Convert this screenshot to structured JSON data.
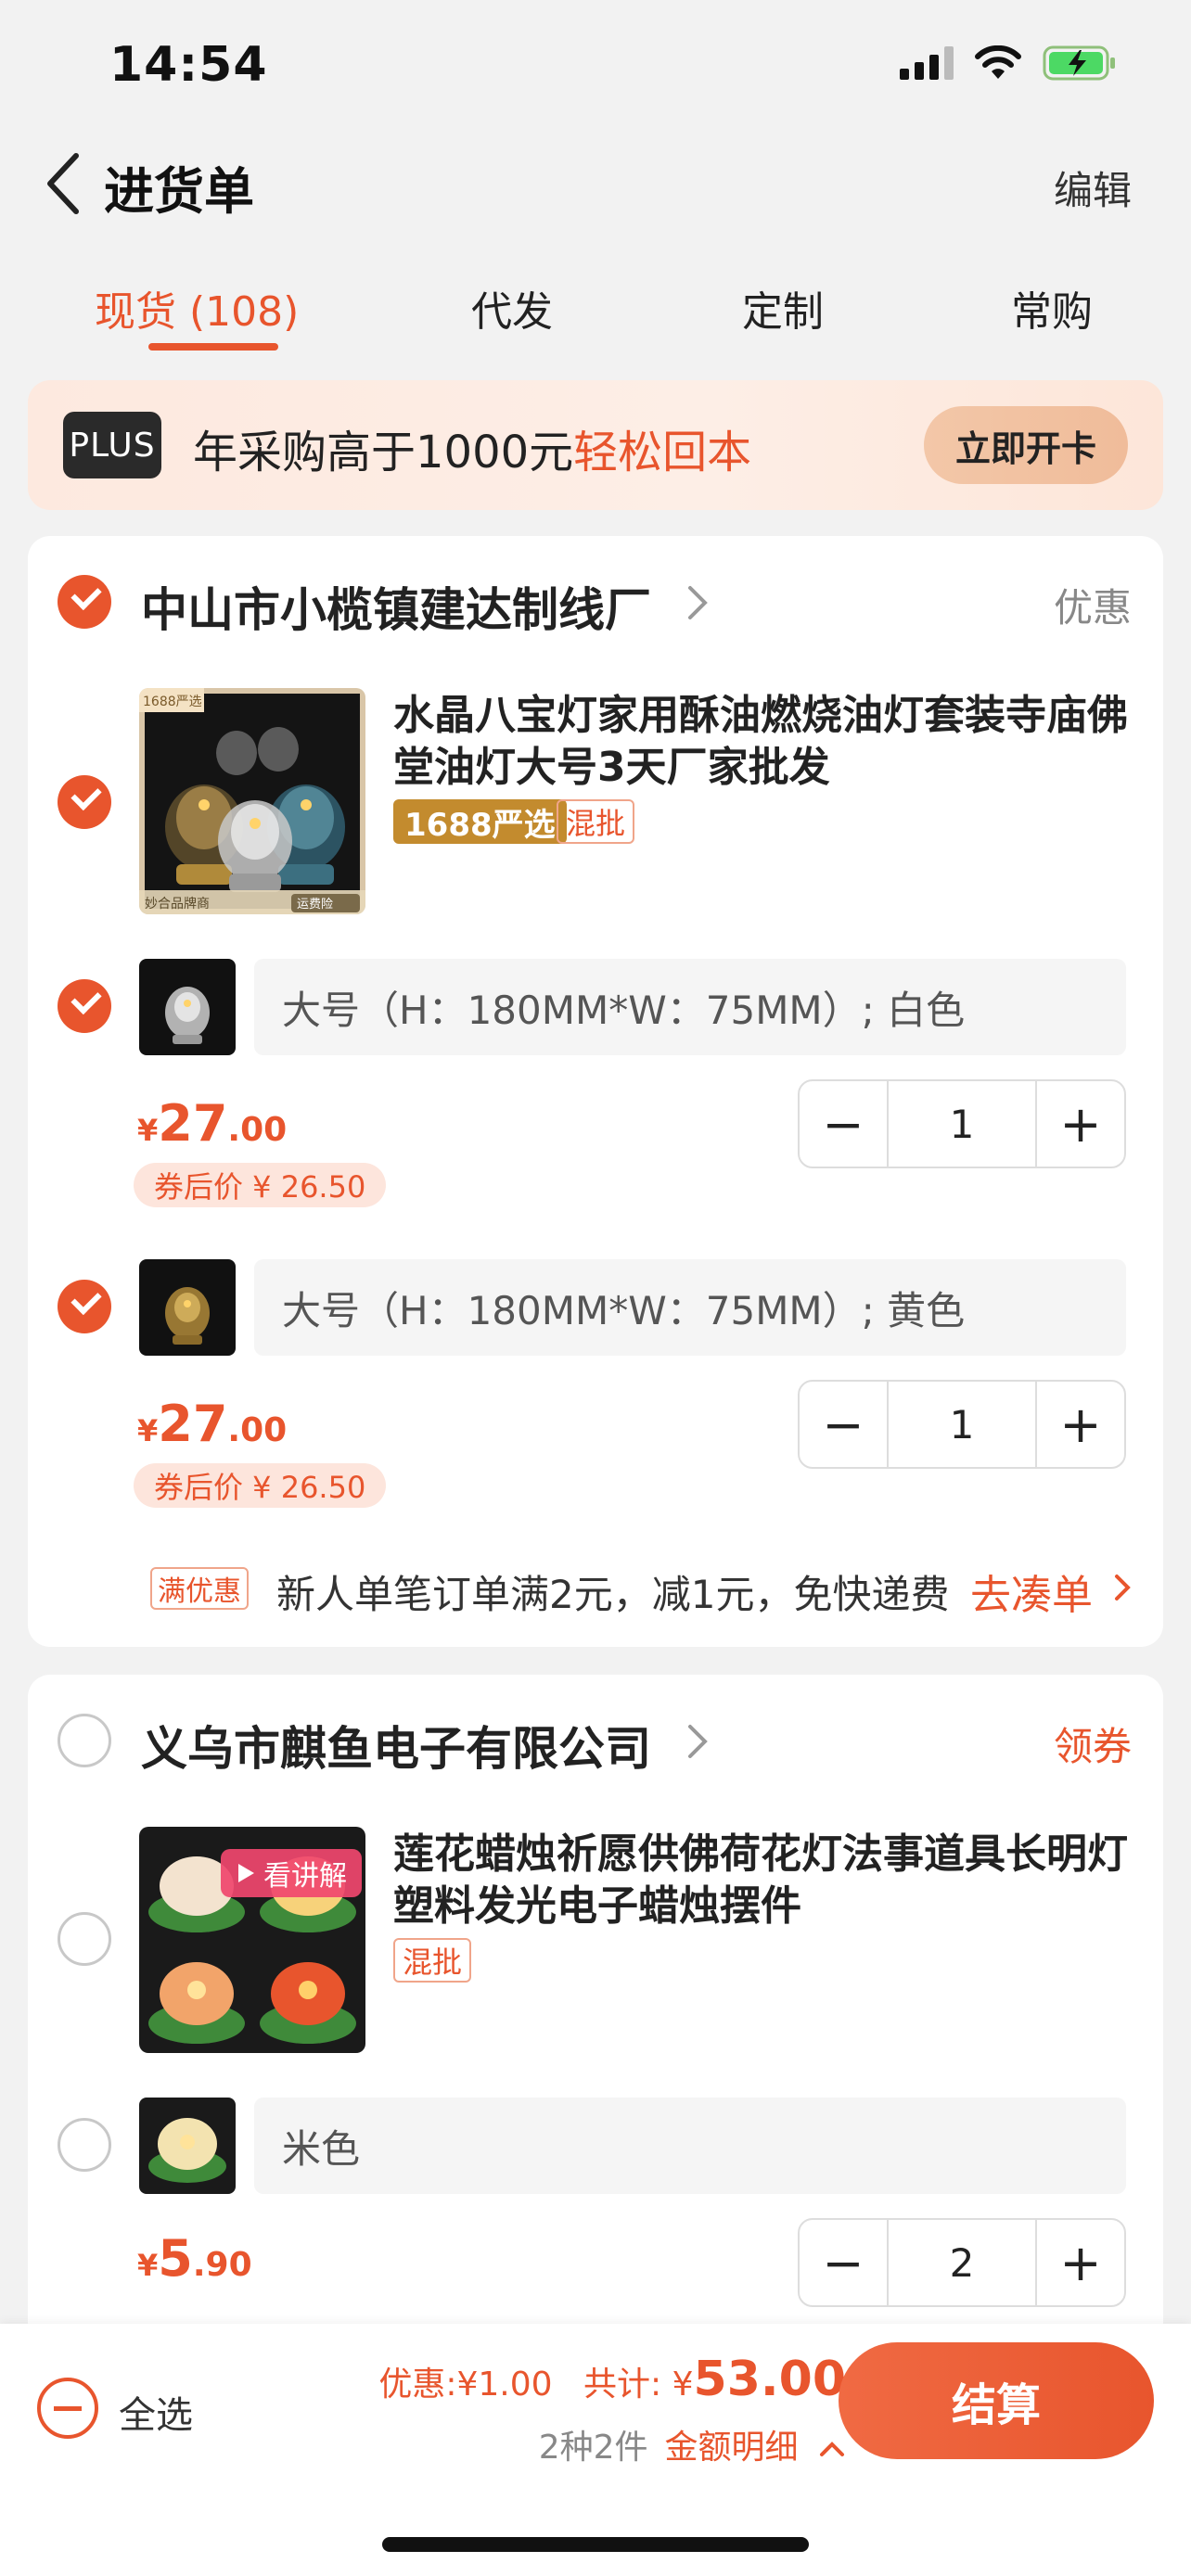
{
  "status_bar": {
    "time": "14:54"
  },
  "nav": {
    "title": "进货单",
    "edit_label": "编辑"
  },
  "tabs": [
    {
      "label": "现货 (108)",
      "active": true
    },
    {
      "label": "代发",
      "active": false
    },
    {
      "label": "定制",
      "active": false
    },
    {
      "label": "常购",
      "active": false
    }
  ],
  "banner": {
    "badge": "PLUS",
    "text_main": "年采购高于1000元",
    "text_highlight": "轻松回本",
    "button_label": "立即开卡"
  },
  "shops": [
    {
      "name": "中山市小榄镇建达制线厂",
      "tag": "优惠",
      "tag_color": "#888888",
      "checked": true,
      "product": {
        "title": "水晶八宝灯家用酥油燃烧油灯套装寺庙佛堂油灯大号3天厂家批发",
        "badge_selected": "1688严选",
        "badge_mixed": "混批",
        "thumb_labels": {
          "top": "1688严选",
          "bottom_left": "妙合品牌商",
          "bottom_right": "运费险"
        }
      },
      "skus": [
        {
          "spec": "大号（H：180MM*W：75MM）; 白色",
          "currency": "¥",
          "price_int": "27",
          "price_dec": ".00",
          "coupon_price": "券后价 ¥ 26.50",
          "quantity": "1",
          "checked": true
        },
        {
          "spec": "大号（H：180MM*W：75MM）; 黄色",
          "currency": "¥",
          "price_int": "27",
          "price_dec": ".00",
          "coupon_price": "券后价 ¥ 26.50",
          "quantity": "1",
          "checked": true
        }
      ],
      "promo": {
        "tag": "满优惠",
        "text": "新人单笔订单满2元，减1元，免快递费",
        "link": "去凑单"
      }
    },
    {
      "name": "义乌市麒鱼电子有限公司",
      "tag": "领券",
      "tag_color": "#e8552d",
      "checked": false,
      "product": {
        "title": "莲花蜡烛祈愿供佛荷花灯法事道具长明灯塑料发光电子蜡烛摆件",
        "badge_mixed": "混批",
        "video_badge": "看讲解"
      },
      "skus": [
        {
          "spec": "米色",
          "currency": "¥",
          "price_int": "5",
          "price_dec": ".90",
          "quantity": "2",
          "checked": false
        }
      ]
    }
  ],
  "bottom_bar": {
    "select_all": "全选",
    "discount_label": "优惠:",
    "discount_value": "¥1.00",
    "total_label": "共计:",
    "total_currency": "¥",
    "total_value": "53.00",
    "count_text": "2种2件",
    "detail_label": "金额明细",
    "checkout_label": "结算"
  }
}
